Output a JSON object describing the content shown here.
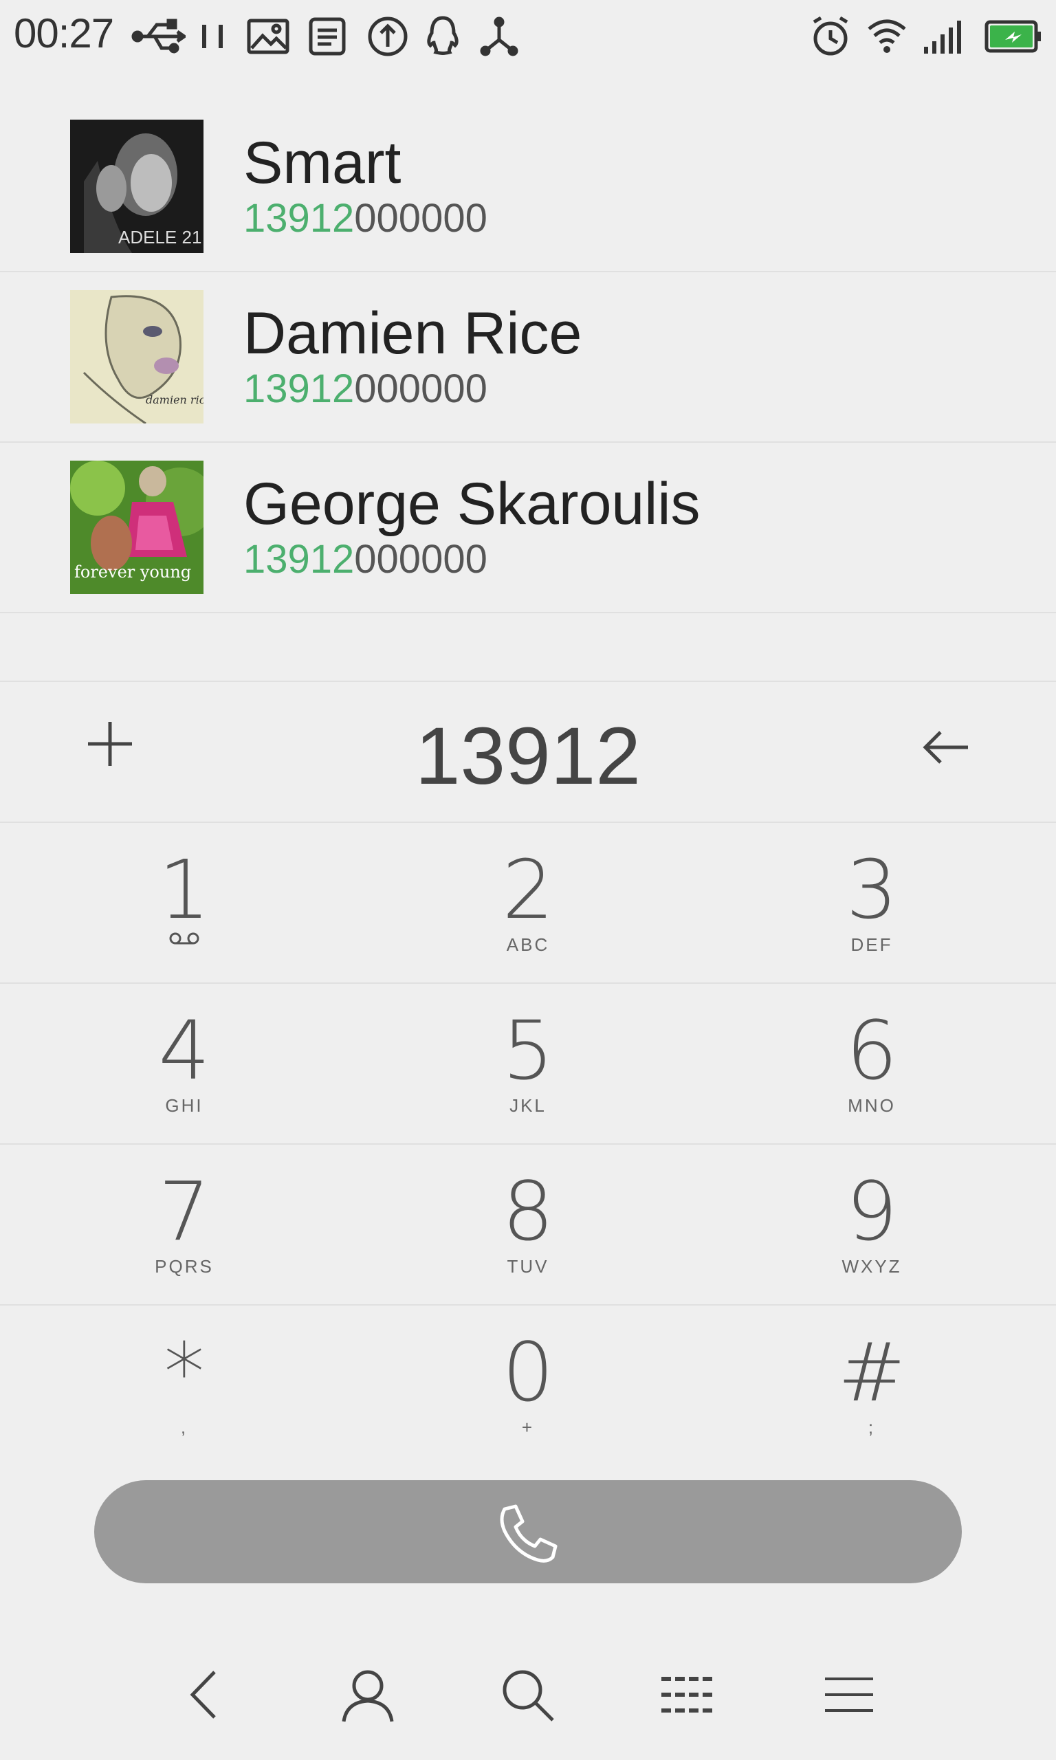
{
  "status_bar": {
    "time": "00:27",
    "left_icons": [
      "usb-icon",
      "pause-icon",
      "image-icon",
      "note-icon",
      "upload-icon",
      "qq-icon",
      "share-icon"
    ],
    "right_icons": [
      "alarm-icon",
      "wifi-icon",
      "signal-icon",
      "battery-charging-icon"
    ],
    "battery_color": "#3bb34a"
  },
  "contacts": [
    {
      "name": "Smart",
      "number_match": "13912",
      "number_rest": "000000",
      "avatar_caption": "ADELE 21"
    },
    {
      "name": "Damien Rice",
      "number_match": "13912",
      "number_rest": "000000",
      "avatar_caption": "damien rice"
    },
    {
      "name": "George Skaroulis",
      "number_match": "13912",
      "number_rest": "000000",
      "avatar_caption": "forever young"
    }
  ],
  "dialer": {
    "input": "13912",
    "add_icon": "plus-icon",
    "backspace_icon": "backspace-arrow-icon"
  },
  "keypad": [
    {
      "digit": "1",
      "letters": ""
    },
    {
      "digit": "2",
      "letters": "ABC"
    },
    {
      "digit": "3",
      "letters": "DEF"
    },
    {
      "digit": "4",
      "letters": "GHI"
    },
    {
      "digit": "5",
      "letters": "JKL"
    },
    {
      "digit": "6",
      "letters": "MNO"
    },
    {
      "digit": "7",
      "letters": "PQRS"
    },
    {
      "digit": "8",
      "letters": "TUV"
    },
    {
      "digit": "9",
      "letters": "WXYZ"
    },
    {
      "digit": "*",
      "letters": ","
    },
    {
      "digit": "0",
      "letters": "+"
    },
    {
      "digit": "#",
      "letters": ";"
    }
  ],
  "call_button": {
    "icon": "phone-icon",
    "color": "#9a9a9a"
  },
  "nav_bar": [
    "back-icon",
    "contacts-icon",
    "search-icon",
    "dialpad-icon",
    "menu-icon"
  ],
  "colors": {
    "match_highlight": "#4caf6e",
    "background": "#efefef"
  }
}
